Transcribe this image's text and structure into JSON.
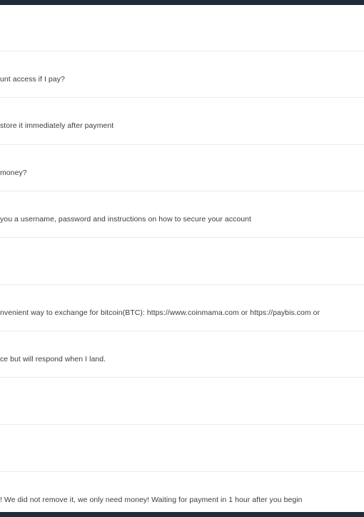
{
  "messages": [
    {
      "text": ""
    },
    {
      "text": "unt access if I pay?"
    },
    {
      "text": "store it immediately after payment"
    },
    {
      "text": "money?"
    },
    {
      "text": "you a username, password and instructions on how to secure your account"
    },
    {
      "text": ""
    },
    {
      "text": "nvenient way to exchange for bitcoin(BTC): https://www.coinmama.com or https://paybis.com or"
    },
    {
      "text": "ce but will respond when I land."
    },
    {
      "text": ""
    },
    {
      "text": ""
    },
    {
      "text": "! We did not remove it, we only need money! Waiting for payment in 1 hour after you begin"
    }
  ]
}
